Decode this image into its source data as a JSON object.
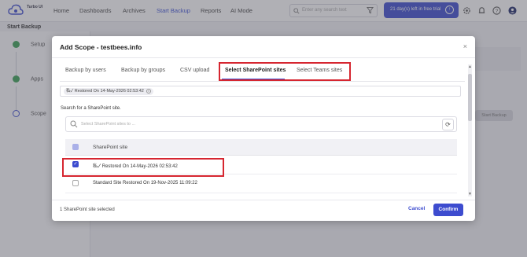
{
  "app": {
    "logo_text": "Turbo UI",
    "nav": [
      "Home",
      "Dashboards",
      "Archives",
      "Start Backup",
      "Reports",
      "AI Mode"
    ],
    "active_nav": "Start Backup",
    "search_placeholder": "Enter any search text",
    "trial_text": "21 day(s) left in free trial"
  },
  "page": {
    "title": "Start Backup",
    "steps": [
      "Setup",
      "Apps",
      "Scope"
    ],
    "bg_button": "Start Backup"
  },
  "modal": {
    "title": "Add Scope - testbees.info",
    "close": "×",
    "tabs": [
      "Backup by users",
      "Backup by groups",
      "CSV upload",
      "Select SharePoint sites",
      "Select Teams sites"
    ],
    "active_tab": "Select SharePoint sites",
    "chip": "私✓ Restored On 14-May-2026 02:53:42",
    "search_label": "Search for a SharePoint site.",
    "search_placeholder": "Select SharePoint sites to ...",
    "table_header": "SharePoint site",
    "rows": [
      {
        "name": "私✓ Restored On 14-May-2026 02:53:42",
        "checked": true
      },
      {
        "name": "Standard Site Restored On 19-Nov-2025 11:09:22",
        "checked": false
      }
    ],
    "footer_text": "1 SharePoint site selected",
    "cancel": "Cancel",
    "confirm": "Confirm"
  },
  "colors": {
    "accent": "#3d4ccf",
    "highlight_box": "#d62630",
    "success": "#3aa055"
  }
}
